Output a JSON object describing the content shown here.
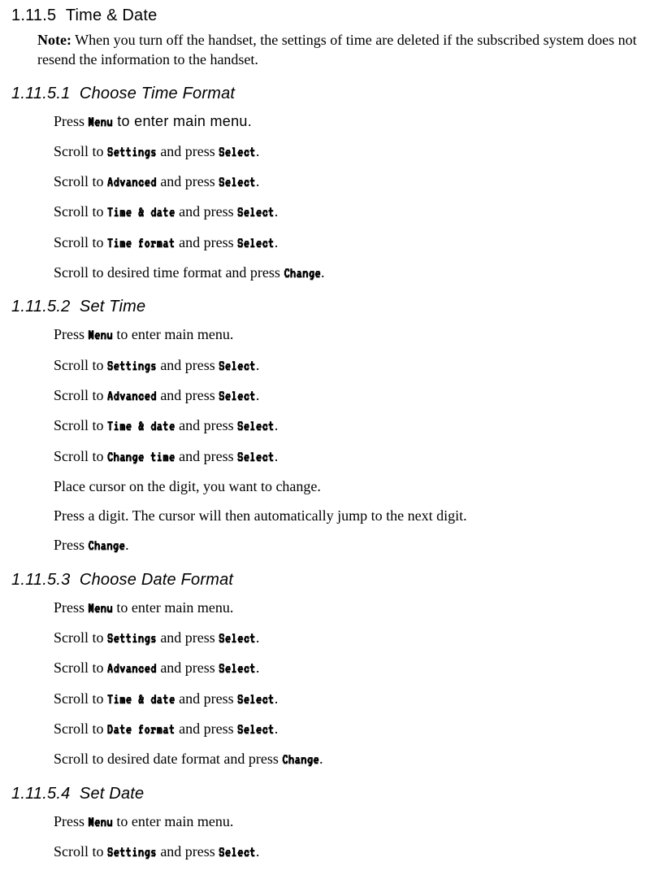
{
  "section": {
    "num": "1.11.5",
    "title": "Time & Date"
  },
  "note": {
    "label": "Note:",
    "text": "When you turn off the handset, the settings of time are deleted if the subscribed system does not resend the information to the handset."
  },
  "sub1": {
    "num": "1.11.5.1",
    "title": "Choose Time Format",
    "steps": [
      {
        "pre": "Press ",
        "lcd": "Menu",
        "post_sans": " to enter main menu."
      },
      {
        "pre": "Scroll to ",
        "lcd": "Settings",
        "post": " and press ",
        "lcd2": "Select",
        "after": "."
      },
      {
        "pre": "Scroll to ",
        "lcd": "Advanced",
        "post": " and press ",
        "lcd2": "Select",
        "after": "."
      },
      {
        "pre": "Scroll to ",
        "lcd": "Time & date",
        "post": " and press ",
        "lcd2": "Select",
        "after": "."
      },
      {
        "pre": "Scroll to ",
        "lcd": "Time format",
        "post": " and press ",
        "lcd2": "Select",
        "after": "."
      },
      {
        "pre": "Scroll to desired time format and press ",
        "lcd": "Change",
        "after": "."
      }
    ]
  },
  "sub2": {
    "num": "1.11.5.2",
    "title": "Set Time",
    "steps": [
      {
        "pre": "Press ",
        "lcd": "Menu",
        "post": " to enter main menu."
      },
      {
        "pre": "Scroll to ",
        "lcd": "Settings",
        "post": " and press ",
        "lcd2": "Select",
        "after": "."
      },
      {
        "pre": "Scroll to ",
        "lcd": "Advanced",
        "post": " and press ",
        "lcd2": "Select",
        "after": "."
      },
      {
        "pre": "Scroll to ",
        "lcd": "Time & date",
        "post": " and press ",
        "lcd2": "Select",
        "after": "."
      },
      {
        "pre": "Scroll to ",
        "lcd": "Change time",
        "post": " and press ",
        "lcd2": "Select",
        "after": "."
      },
      {
        "plain": "Place cursor on the digit, you want to change."
      },
      {
        "plain": "Press a digit. The cursor will then automatically jump to the next digit."
      },
      {
        "pre": "Press ",
        "lcd": "Change",
        "after": "."
      }
    ]
  },
  "sub3": {
    "num": "1.11.5.3",
    "title": "Choose Date Format",
    "steps": [
      {
        "pre": "Press ",
        "lcd": "Menu",
        "post": " to enter main menu."
      },
      {
        "pre": "Scroll to ",
        "lcd": "Settings",
        "post": " and press ",
        "lcd2": "Select",
        "after": "."
      },
      {
        "pre": "Scroll to ",
        "lcd": "Advanced",
        "post": " and press ",
        "lcd2": "Select",
        "after": "."
      },
      {
        "pre": "Scroll to ",
        "lcd": "Time & date",
        "post": " and press ",
        "lcd2": "Select",
        "after": "."
      },
      {
        "pre": "Scroll to ",
        "lcd": "Date format",
        "post": " and press ",
        "lcd2": "Select",
        "after": "."
      },
      {
        "pre": "Scroll to desired date format and press ",
        "lcd": "Change",
        "after": "."
      }
    ]
  },
  "sub4": {
    "num": "1.11.5.4",
    "title": "Set Date",
    "steps": [
      {
        "pre": "Press ",
        "lcd": "Menu",
        "post": " to enter main menu."
      },
      {
        "pre": "Scroll to ",
        "lcd": "Settings",
        "post": " and press ",
        "lcd2": "Select",
        "after": "."
      }
    ]
  }
}
